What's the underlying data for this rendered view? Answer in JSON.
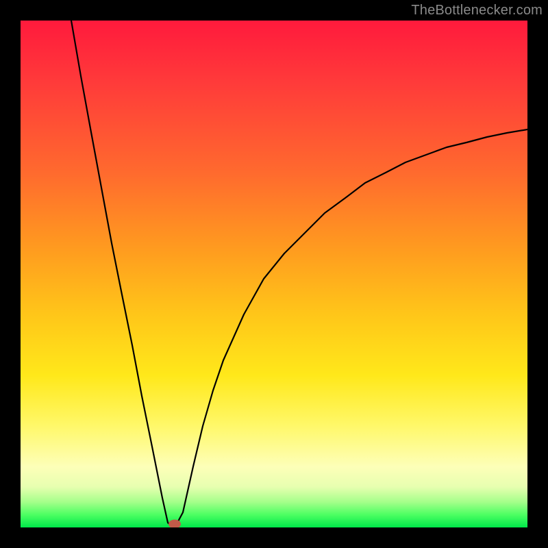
{
  "watermark": "TheBottlenecker.com",
  "chart_data": {
    "type": "line",
    "title": "",
    "xlabel": "",
    "ylabel": "",
    "xlim": [
      0,
      100
    ],
    "ylim": [
      0,
      100
    ],
    "x": [
      10,
      12,
      14,
      16,
      18,
      20,
      22,
      24,
      26,
      28,
      29,
      30,
      31,
      32,
      34,
      36,
      38,
      40,
      44,
      48,
      52,
      56,
      60,
      64,
      68,
      72,
      76,
      80,
      84,
      88,
      92,
      96,
      100
    ],
    "values": [
      100,
      89,
      78,
      67,
      56,
      46,
      36,
      26,
      16,
      6,
      1,
      0,
      1,
      3,
      12,
      20,
      27,
      33,
      42,
      49,
      54,
      58,
      62,
      65,
      68,
      70,
      72,
      73.5,
      75,
      76,
      77,
      77.8,
      78.5
    ],
    "min_point": {
      "x": 30,
      "y": 0
    },
    "background_gradient": {
      "top_color": "#ff1a3c",
      "mid_color": "#ffe81a",
      "bottom_color": "#00e84a"
    },
    "annotations": []
  }
}
